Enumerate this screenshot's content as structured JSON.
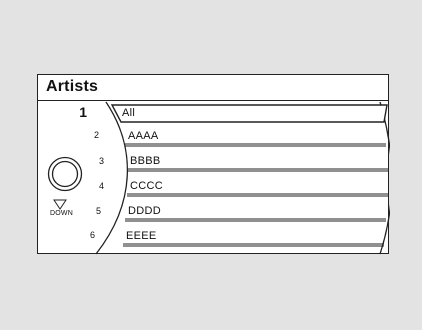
{
  "header": {
    "title": "Artists"
  },
  "list": {
    "numbers": [
      "1",
      "2",
      "3",
      "4",
      "5",
      "6"
    ],
    "items": [
      "All",
      "AAAA",
      "BBBB",
      "CCCC",
      "DDDD",
      "EEEE"
    ]
  },
  "knob": {
    "down_label": "DOWN"
  }
}
